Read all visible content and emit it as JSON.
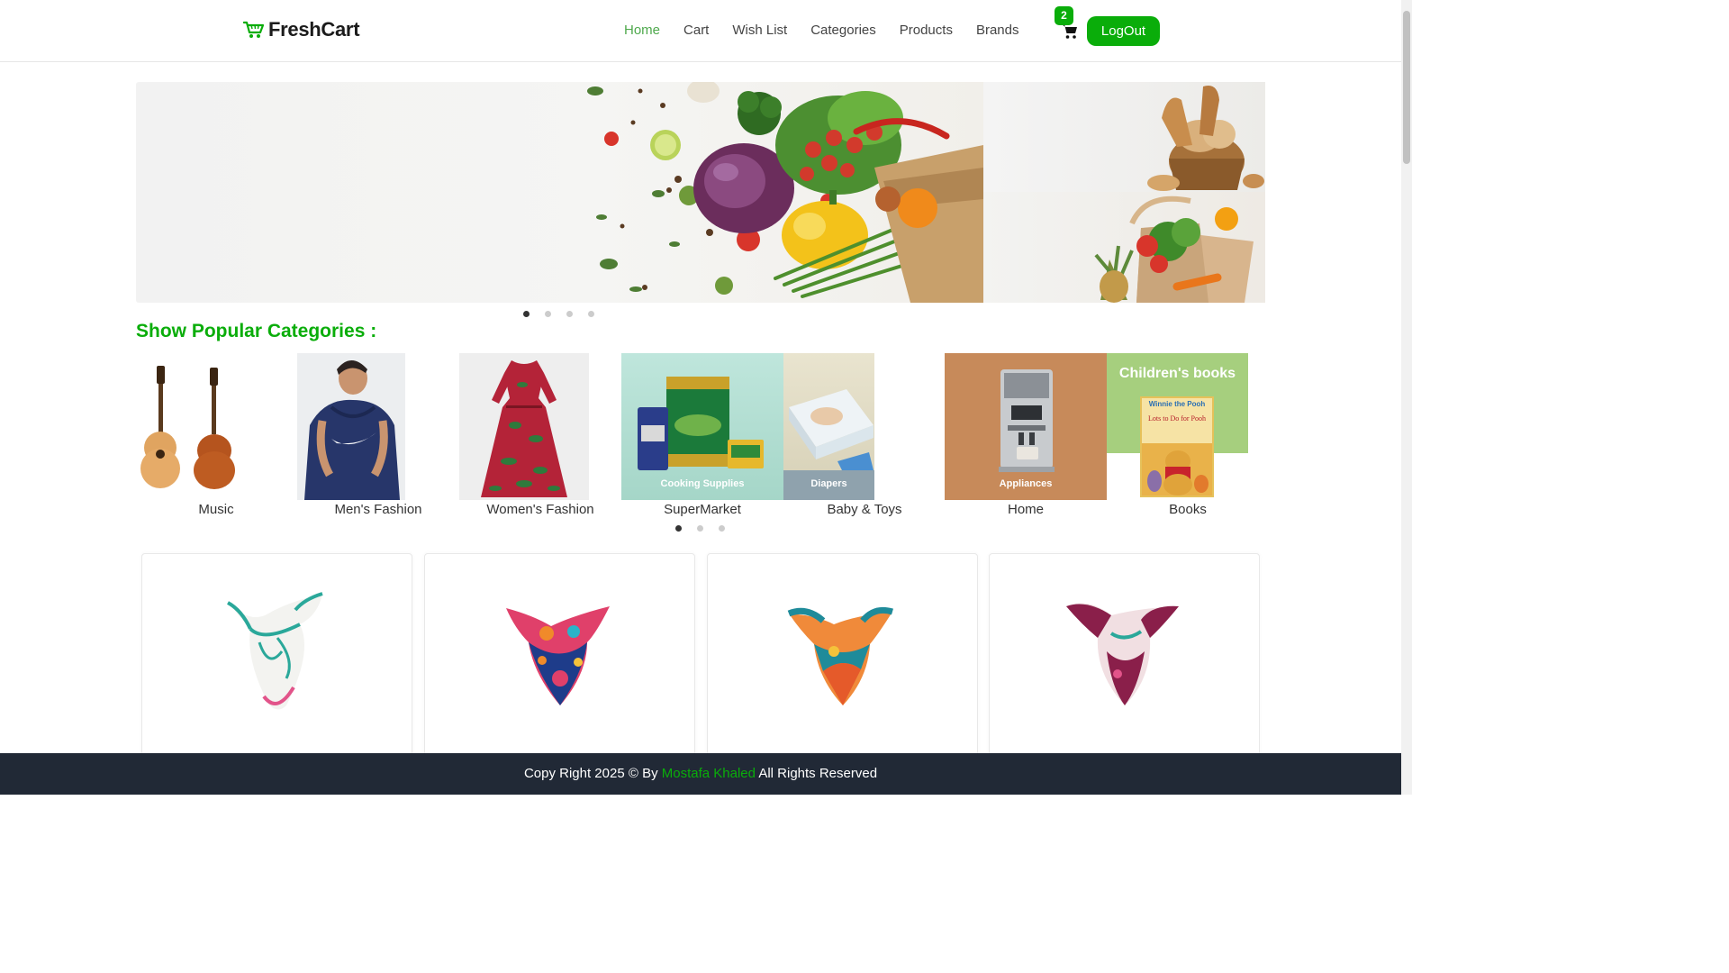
{
  "brand": {
    "name": "FreshCart"
  },
  "nav": {
    "links": [
      {
        "label": "Home",
        "active": true
      },
      {
        "label": "Cart",
        "active": false
      },
      {
        "label": "Wish List",
        "active": false
      },
      {
        "label": "Categories",
        "active": false
      },
      {
        "label": "Products",
        "active": false
      },
      {
        "label": "Brands",
        "active": false
      }
    ],
    "cart_count": "2",
    "logout_label": "LogOut"
  },
  "colors": {
    "accent": "#0aad0a",
    "nav_active": "#4fa94d",
    "footer_bg": "#212936"
  },
  "hero": {
    "slides": 4,
    "active_slide": 1
  },
  "categories": {
    "title": "Show Popular Categories :",
    "items": [
      {
        "name": "Music",
        "image_label": ""
      },
      {
        "name": "Men's Fashion",
        "image_label": ""
      },
      {
        "name": "Women's Fashion",
        "image_label": ""
      },
      {
        "name": "SuperMarket",
        "image_label": "Cooking Supplies"
      },
      {
        "name": "Baby & Toys",
        "image_label": "Diapers"
      },
      {
        "name": "Home",
        "image_label": "Appliances"
      },
      {
        "name": "Books",
        "image_label": "Children's books"
      }
    ],
    "slides": 3,
    "active_slide": 1
  },
  "books_cover": {
    "line1": "Winnie the Pooh",
    "line2": "Lots to Do for Pooh"
  },
  "products": [
    {
      "image": "scarf-white-teal"
    },
    {
      "image": "scarf-pink-blue"
    },
    {
      "image": "scarf-teal-orange"
    },
    {
      "image": "scarf-maroon-pink"
    }
  ],
  "footer": {
    "prefix": "Copy Right 2025 © By",
    "author": "Mostafa Khaled",
    "suffix": "All Rights Reserved"
  }
}
